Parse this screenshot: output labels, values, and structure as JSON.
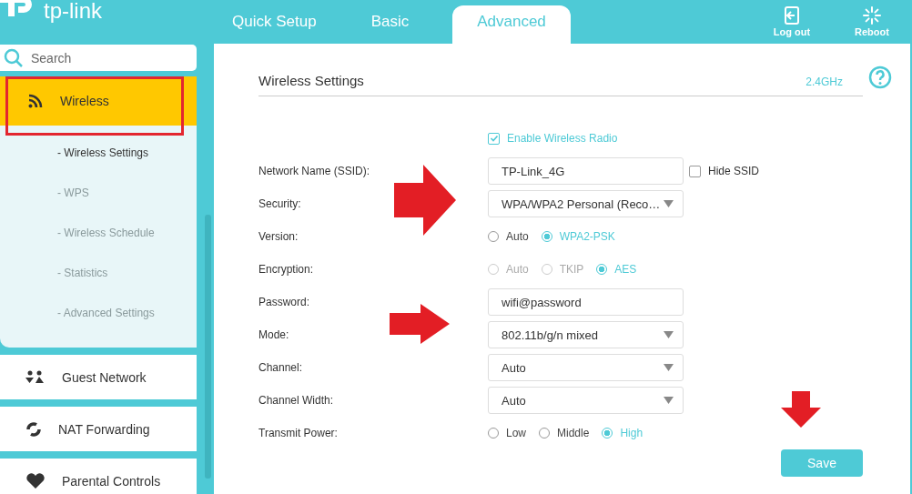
{
  "brand": {
    "name": "tp-link"
  },
  "tabs": [
    {
      "label": "Quick Setup",
      "selected": false
    },
    {
      "label": "Basic",
      "selected": false
    },
    {
      "label": "Advanced",
      "selected": true
    }
  ],
  "header_actions": [
    {
      "label": "Log out",
      "kind": "logout"
    },
    {
      "label": "Reboot",
      "kind": "reboot"
    }
  ],
  "sidebar": {
    "search": {
      "placeholder": "Search"
    },
    "items": [
      {
        "label": "Wireless",
        "kind": "wifi",
        "selected": true,
        "expanded": true,
        "children": [
          {
            "label": "- Wireless Settings",
            "selected": true
          },
          {
            "label": "- WPS",
            "selected": false
          },
          {
            "label": "- Wireless Schedule",
            "selected": false
          },
          {
            "label": "- Statistics",
            "selected": false
          },
          {
            "label": "- Advanced Settings",
            "selected": false
          }
        ]
      },
      {
        "label": "Guest Network",
        "kind": "guest",
        "selected": false,
        "expanded": false
      },
      {
        "label": "NAT Forwarding",
        "kind": "nat",
        "selected": false,
        "expanded": false
      },
      {
        "label": "Parental Controls",
        "kind": "heart",
        "selected": false,
        "expanded": false
      }
    ]
  },
  "panel": {
    "title": "Wireless Settings",
    "band": "2.4GHz",
    "rows": [
      {
        "kind": "checkbox",
        "label": "Enable Wireless Radio",
        "checked": true
      },
      {
        "kind": "text",
        "label": "Network Name (SSID):",
        "value": "TP-Link_4G",
        "extra": {
          "label": "Hide SSID",
          "checked": false
        }
      },
      {
        "kind": "select",
        "label": "Security:",
        "value": "WPA/WPA2 Personal (Reco…"
      },
      {
        "kind": "radio",
        "label": "Version:",
        "options": [
          {
            "label": "Auto",
            "selected": false,
            "disabled": false
          },
          {
            "label": "WPA2-PSK",
            "selected": true,
            "disabled": false
          }
        ]
      },
      {
        "kind": "radio",
        "label": "Encryption:",
        "options": [
          {
            "label": "Auto",
            "selected": false,
            "disabled": true
          },
          {
            "label": "TKIP",
            "selected": false,
            "disabled": true
          },
          {
            "label": "AES",
            "selected": true,
            "disabled": false
          }
        ]
      },
      {
        "kind": "text",
        "label": "Password:",
        "value": "wifi@password"
      },
      {
        "kind": "select",
        "label": "Mode:",
        "value": "802.11b/g/n mixed"
      },
      {
        "kind": "select",
        "label": "Channel:",
        "value": "Auto"
      },
      {
        "kind": "select",
        "label": "Channel Width:",
        "value": "Auto"
      },
      {
        "kind": "radio",
        "label": "Transmit Power:",
        "options": [
          {
            "label": "Low",
            "selected": false,
            "disabled": false
          },
          {
            "label": "Middle",
            "selected": false,
            "disabled": false
          },
          {
            "label": "High",
            "selected": true,
            "disabled": false
          }
        ]
      }
    ],
    "save_button": "Save"
  }
}
